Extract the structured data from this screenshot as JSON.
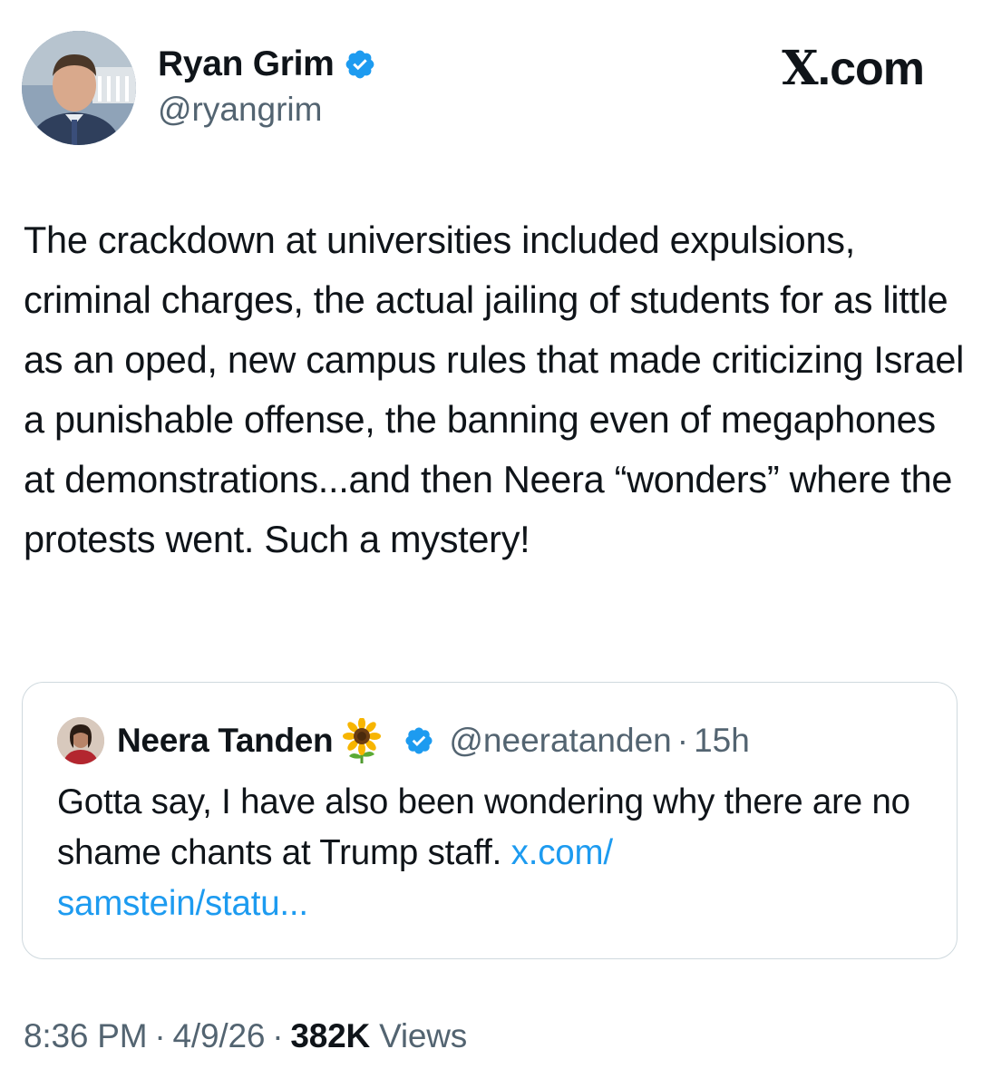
{
  "brand": {
    "logo_text": "X.com"
  },
  "author": {
    "name": "Ryan Grim",
    "handle": "@ryangrim",
    "verified": true,
    "avatar_icon": "profile-photo"
  },
  "tweet": {
    "text": "The crackdown at universities included expulsions, criminal charges, the actual jailing of students for as little as an oped, new campus rules that made criticizing Israel a punishable offense, the banning even of megaphones at demonstrations...and then Neera “wonders” where the protests went. Such a mystery!"
  },
  "quoted_tweet": {
    "author_name": "Neera Tanden",
    "name_emoji": "sunflower",
    "verified": true,
    "handle": "@neeratanden",
    "separator": "·",
    "time": "15h",
    "text": "Gotta say, I have also been wondering why there are no shame chants at Trump staff.",
    "link_text": "x.com/\nsamstein/statu..."
  },
  "meta": {
    "time": "8:36 PM",
    "date": "4/9/26",
    "separator": "·",
    "views_count": "382K",
    "views_label": "Views"
  },
  "colors": {
    "text": "#0f1419",
    "secondary": "#536471",
    "link": "#1d9bf0",
    "verified": "#1d9bf0",
    "border": "#cfd9de"
  }
}
